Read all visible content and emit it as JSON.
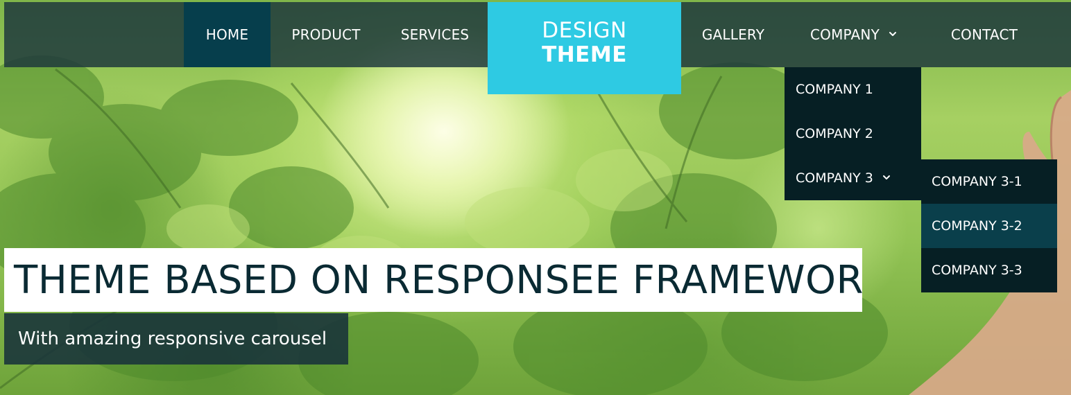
{
  "nav": {
    "items": [
      {
        "label": "HOME",
        "active": true
      },
      {
        "label": "PRODUCT"
      },
      {
        "label": "SERVICES"
      },
      {
        "label": "GALLERY"
      },
      {
        "label": "COMPANY",
        "has_dropdown": true,
        "icon": "chevron-down-icon"
      },
      {
        "label": "CONTACT"
      }
    ]
  },
  "logo": {
    "line1": "DESIGN",
    "line2": "THEME"
  },
  "company_dropdown": {
    "items": [
      {
        "label": "COMPANY 1"
      },
      {
        "label": "COMPANY 2"
      },
      {
        "label": "COMPANY 3",
        "has_submenu": true,
        "icon": "chevron-down-icon"
      }
    ]
  },
  "company3_submenu": {
    "items": [
      {
        "label": "COMPANY 3-1"
      },
      {
        "label": "COMPANY 3-2",
        "active": true
      },
      {
        "label": "COMPANY 3-3"
      }
    ]
  },
  "hero": {
    "title": "THEME BASED ON RESPONSEE FRAMEWORK",
    "subtitle": "With amazing responsive carousel"
  },
  "colors": {
    "nav_bg": "#1b343c",
    "nav_active": "#063e4c",
    "logo_bg": "#2ecae3",
    "dropdown_bg": "#061f24",
    "submenu_active": "#0a3f4b",
    "hero_title_text": "#0a2a33"
  }
}
